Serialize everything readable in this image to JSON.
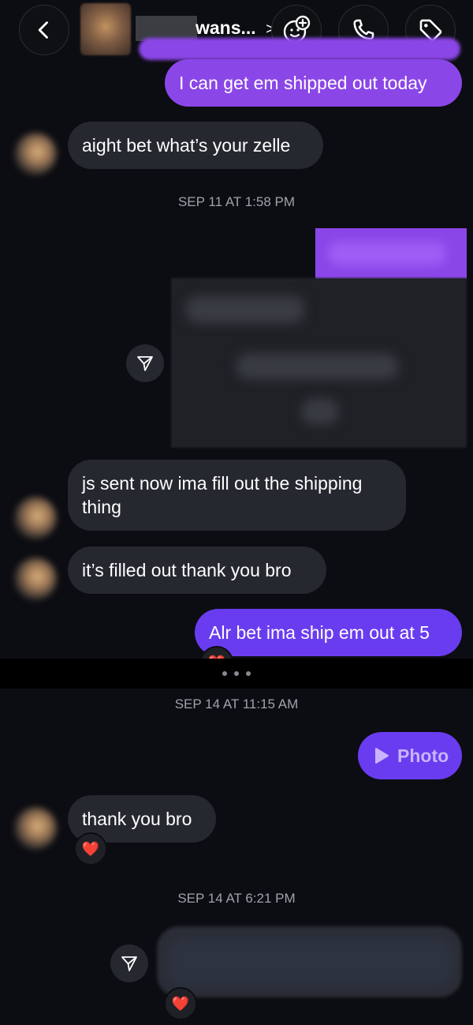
{
  "header": {
    "contact_name": "wans...",
    "chevron": ">",
    "icons": [
      "back-icon",
      "sticker-add-icon",
      "phone-icon",
      "tag-icon"
    ]
  },
  "messages": {
    "m1": "I can get em shipped out today",
    "m2": "aight bet what’s your zelle",
    "ts1": "SEP 11 AT 1:58 PM",
    "m3": "js sent now ima fill out the shipping thing",
    "m4": "it’s filled out thank you bro",
    "m5": "Alr bet ima ship em out at 5",
    "ts2": "SEP 14 AT 11:15 AM",
    "m6": "Photo",
    "m7": "thank you bro",
    "ts3": "SEP 14 AT 6:21 PM"
  },
  "reactions": {
    "heart": "❤️"
  },
  "colors": {
    "outgoing_purple": "#8b46e8",
    "outgoing_violet": "#6a3cf0",
    "incoming_gray": "#262830",
    "background": "#0c0d12"
  }
}
